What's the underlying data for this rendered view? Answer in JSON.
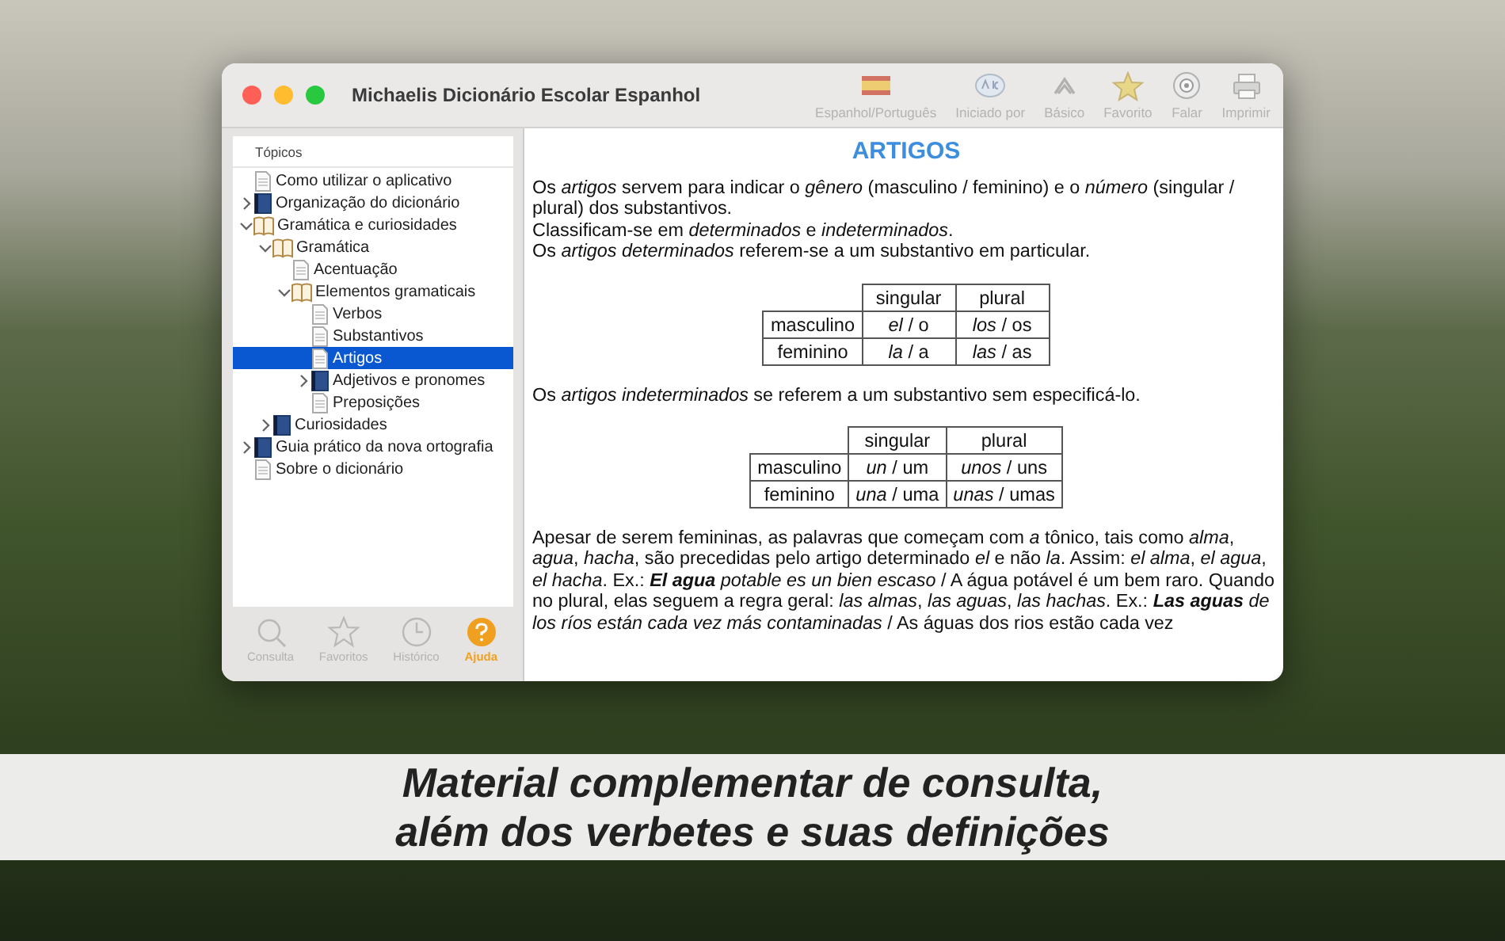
{
  "window": {
    "title": "Michaelis Dicionário Escolar Espanhol"
  },
  "toolbar": [
    {
      "kind": "flag",
      "label": "Espanhol/Português"
    },
    {
      "kind": "abc",
      "label": "Iniciado por"
    },
    {
      "kind": "chevron",
      "label": "Básico"
    },
    {
      "kind": "star",
      "label": "Favorito"
    },
    {
      "kind": "speaker",
      "label": "Falar"
    },
    {
      "kind": "printer",
      "label": "Imprimir"
    }
  ],
  "sidebar": {
    "header": "Tópicos",
    "tree": [
      {
        "label": "Como utilizar o aplicativo",
        "kind": "page",
        "selected": false
      },
      {
        "label": "Organização do dicionário",
        "kind": "section",
        "expanded": false,
        "selected": false
      },
      {
        "label": "Gramática e curiosidades",
        "kind": "section",
        "expanded": true,
        "selected": false,
        "children": [
          {
            "label": "Gramática",
            "kind": "section",
            "expanded": true,
            "selected": false,
            "children": [
              {
                "label": "Acentuação",
                "kind": "page",
                "selected": false
              },
              {
                "label": "Elementos gramaticais",
                "kind": "section",
                "expanded": true,
                "selected": false,
                "children": [
                  {
                    "label": "Verbos",
                    "kind": "page",
                    "selected": false
                  },
                  {
                    "label": "Substantivos",
                    "kind": "page",
                    "selected": false
                  },
                  {
                    "label": "Artigos",
                    "kind": "page",
                    "selected": true
                  },
                  {
                    "label": "Adjetivos e pronomes",
                    "kind": "section",
                    "expanded": false,
                    "selected": false
                  },
                  {
                    "label": "Preposições",
                    "kind": "page",
                    "selected": false
                  }
                ]
              }
            ]
          },
          {
            "label": "Curiosidades",
            "kind": "section",
            "expanded": false,
            "selected": false
          }
        ]
      },
      {
        "label": "Guia prático da nova ortografia",
        "kind": "section",
        "expanded": false,
        "selected": false
      },
      {
        "label": "Sobre o dicionário",
        "kind": "page",
        "selected": false
      }
    ]
  },
  "bottom_tabs": [
    {
      "kind": "search",
      "label": "Consulta",
      "selected": false
    },
    {
      "kind": "star",
      "label": "Favoritos",
      "selected": false
    },
    {
      "kind": "clock",
      "label": "Histórico",
      "selected": false
    },
    {
      "kind": "help",
      "label": "Ajuda",
      "selected": true
    }
  ],
  "article": {
    "title": "ARTIGOS",
    "blocks": [
      {
        "kind": "paragraph",
        "lines": [
          "Os *artigos* servem para indicar o *gênero* (masculino / feminino) e o *número* (singular / plural) dos substantivos.",
          "Classificam-se em *determinados* e *indeterminados*.",
          "Os *artigos determinados* referem-se a um substantivo em particular."
        ]
      },
      {
        "kind": "table",
        "columns": [
          "",
          "singular",
          "plural"
        ],
        "rows": [
          [
            "masculino",
            "*el* / o",
            "*los* / os"
          ],
          [
            "feminino",
            "*la* / a",
            "*las* / as"
          ]
        ]
      },
      {
        "kind": "paragraph",
        "lines": [
          "Os *artigos indeterminados* se referem a um substantivo sem especificá-lo."
        ]
      },
      {
        "kind": "table",
        "columns": [
          "",
          "singular",
          "plural"
        ],
        "rows": [
          [
            "masculino",
            "*un* / um",
            "*unos* / uns"
          ],
          [
            "feminino",
            "*una* / uma",
            "*unas* / umas"
          ]
        ]
      },
      {
        "kind": "paragraph",
        "lines": [
          "Apesar de serem femininas, as palavras que começam com *a* tônico, tais como *alma*, *agua*, *hacha*, são precedidas pelo artigo determinado *el* e não *la*. Assim: *el alma*, *el agua*, *el hacha*. Ex.: **El agua** *potable es un bien escaso* / A água potável é um bem raro. Quando no plural, elas seguem a regra geral: *las almas*, *las aguas*, *las hachas*. Ex.: **Las aguas** *de los ríos están cada vez más contaminadas* / As águas dos rios estão cada vez"
        ]
      }
    ]
  },
  "caption": [
    "Material complementar de consulta,",
    "além dos verbetes e suas definições"
  ]
}
